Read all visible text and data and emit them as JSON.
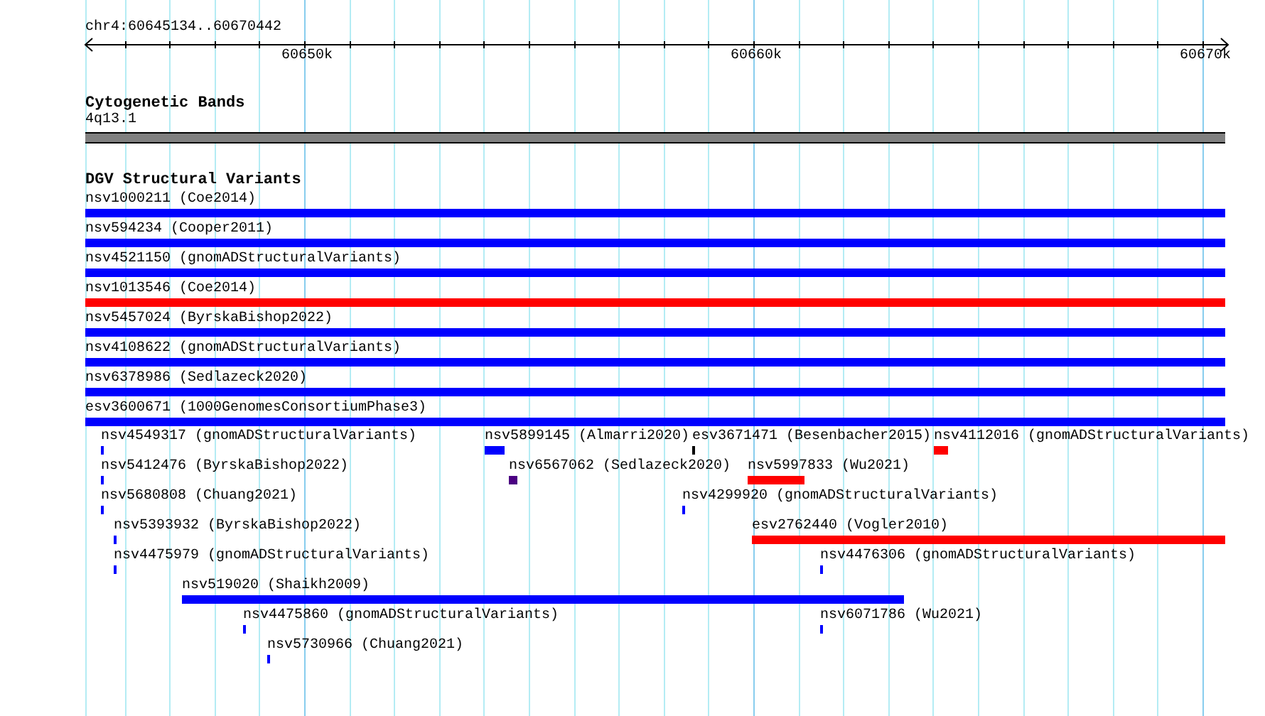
{
  "ruler": {
    "location": "chr4:60645134..60670442",
    "ticks": [
      "60650k",
      "60660k",
      "60670k"
    ]
  },
  "cytobands": {
    "title": "Cytogenetic Bands",
    "bands": [
      {
        "label": "4q13.1"
      }
    ]
  },
  "dgv": {
    "title": "DGV Structural Variants",
    "features": [
      {
        "label": "nsv1000211 (Coe2014)",
        "color": "#0000ff"
      },
      {
        "label": "nsv594234 (Cooper2011)",
        "color": "#0000ff"
      },
      {
        "label": "nsv4521150 (gnomADStructuralVariants)",
        "color": "#0000ff"
      },
      {
        "label": "nsv1013546 (Coe2014)",
        "color": "#ff0000"
      },
      {
        "label": "nsv5457024 (ByrskaBishop2022)",
        "color": "#0000ff"
      },
      {
        "label": "nsv4108622 (gnomADStructuralVariants)",
        "color": "#0000ff"
      },
      {
        "label": "nsv6378986 (Sedlazeck2020)",
        "color": "#0000ff"
      },
      {
        "label": "esv3600671 (1000GenomesConsortiumPhase3)",
        "color": "#0000ff"
      },
      {
        "label": "nsv4549317 (gnomADStructuralVariants)",
        "color": "#0000ff"
      },
      {
        "label": "nsv5899145 (Almarri2020)",
        "color": "#0000ff"
      },
      {
        "label": "esv3671471 (Besenbacher2015)",
        "color": "#000000"
      },
      {
        "label": "nsv4112016 (gnomADStructuralVariants)",
        "color": "#ff0000"
      },
      {
        "label": "nsv5412476 (ByrskaBishop2022)",
        "color": "#0000ff"
      },
      {
        "label": "nsv6567062 (Sedlazeck2020)",
        "color": "#4b0082"
      },
      {
        "label": "nsv5997833 (Wu2021)",
        "color": "#ff0000"
      },
      {
        "label": "nsv5680808 (Chuang2021)",
        "color": "#0000ff"
      },
      {
        "label": "nsv4299920 (gnomADStructuralVariants)",
        "color": "#0000ff"
      },
      {
        "label": "nsv5393932 (ByrskaBishop2022)",
        "color": "#0000ff"
      },
      {
        "label": "esv2762440 (Vogler2010)",
        "color": "#ff0000"
      },
      {
        "label": "nsv4475979 (gnomADStructuralVariants)",
        "color": "#0000ff"
      },
      {
        "label": "nsv4476306 (gnomADStructuralVariants)",
        "color": "#0000ff"
      },
      {
        "label": "nsv519020 (Shaikh2009)",
        "color": "#0000ff"
      },
      {
        "label": "nsv4475860 (gnomADStructuralVariants)",
        "color": "#0000ff"
      },
      {
        "label": "nsv6071786 (Wu2021)",
        "color": "#0000ff"
      },
      {
        "label": "nsv5730966 (Chuang2021)",
        "color": "#0000ff"
      }
    ]
  }
}
